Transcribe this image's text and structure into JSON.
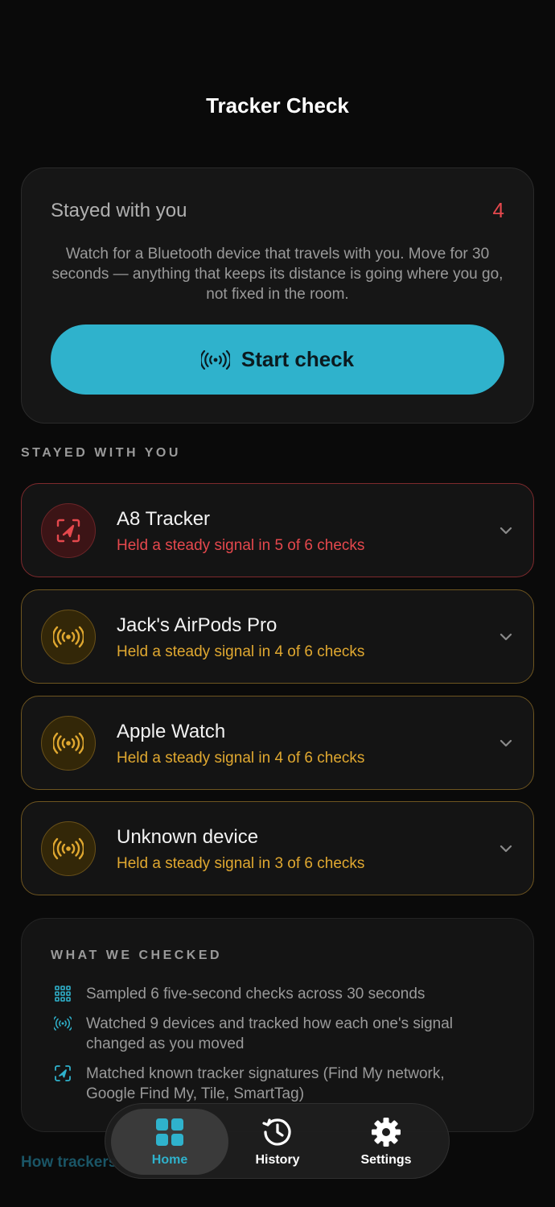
{
  "header": {
    "title": "Tracker Check"
  },
  "hero": {
    "label": "Stayed with you",
    "count": "4",
    "description": "Watch for a Bluetooth device that travels with you. Move for 30 seconds — anything that keeps its distance is going where you go, not fixed in the room.",
    "button_label": "Start check",
    "button_icon": "signal-waves-icon"
  },
  "stayed_section": {
    "title": "STAYED WITH YOU"
  },
  "devices": [
    {
      "name": "A8 Tracker",
      "status": "Held a steady signal in 5 of 6 checks",
      "icon": "tracker-target-icon",
      "severity": "red",
      "color": "#e5484d"
    },
    {
      "name": "Jack's AirPods Pro",
      "status": "Held a steady signal in 4 of 6 checks",
      "icon": "signal-waves-icon",
      "severity": "amber",
      "color": "#e0a830"
    },
    {
      "name": "Apple Watch",
      "status": "Held a steady signal in 4 of 6 checks",
      "icon": "signal-waves-icon",
      "severity": "amber",
      "color": "#e0a830"
    },
    {
      "name": "Unknown device",
      "status": "Held a steady signal in 3 of 6 checks",
      "icon": "signal-waves-icon",
      "severity": "amber",
      "color": "#e0a830"
    }
  ],
  "what_we_checked": {
    "title": "WHAT WE CHECKED",
    "items": [
      {
        "icon": "grid-icon",
        "text": "Sampled 6 five-second checks across 30 seconds"
      },
      {
        "icon": "signal-waves-icon",
        "text": "Watched 9 devices and tracked how each one's signal changed as you moved"
      },
      {
        "icon": "tracker-target-icon",
        "text": "Matched known tracker signatures (Find My network, Google Find My, Tile, SmartTag)"
      }
    ]
  },
  "footer": {
    "link_text": "How trackers are identified"
  },
  "tabbar": {
    "tabs": [
      {
        "label": "Home",
        "icon": "home-grid-icon",
        "active": true
      },
      {
        "label": "History",
        "icon": "history-clock-icon",
        "active": false
      },
      {
        "label": "Settings",
        "icon": "gear-icon",
        "active": false
      }
    ]
  },
  "colors": {
    "accent": "#2fb2cc",
    "danger": "#e5484d",
    "warning": "#e0a830",
    "background": "#0a0a0a"
  }
}
